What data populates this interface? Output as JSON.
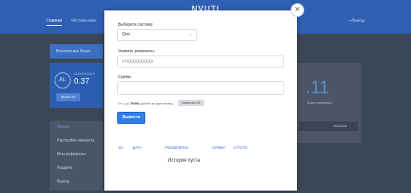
{
  "background": {
    "logo": "NVUTI",
    "nav": [
      "Главная",
      "Честная игра"
    ],
    "exit_label": "Выход",
    "bonus_label": "Бесплатные бонус",
    "user": {
      "avatar": "AL",
      "id_text": "ALXXXXXXXX",
      "balance": "0.37",
      "withdraw_label": "Вывести"
    },
    "menu": [
      "Играть",
      "Настройки аккаунта",
      "Мои рефералы",
      "Раздача",
      "Выход"
    ],
    "big_number": ".11",
    "chance_label": "Шанс выигрыша",
    "more_label": "Больше"
  },
  "modal": {
    "system_label": "Выберите систему",
    "system_value": "Qiwi",
    "requisites_label": "Укажите реквизиты:",
    "requisites_placeholder": "+7XXXXXXXXXX",
    "sum_label": "Сумма:",
    "sum_value": "",
    "hint_prefix": "От 4 до",
    "hint_amount": "75000",
    "hint_suffix": "рублей за один вывод",
    "commission": "Комиссия 1%",
    "withdraw_button": "Вывести",
    "table_columns": [
      "ID",
      "ДАТА",
      "РЕКВИЗИТЫ",
      "СУММА",
      "СТАТУС"
    ],
    "empty_text": "История пуста",
    "close_symbol": "×"
  }
}
